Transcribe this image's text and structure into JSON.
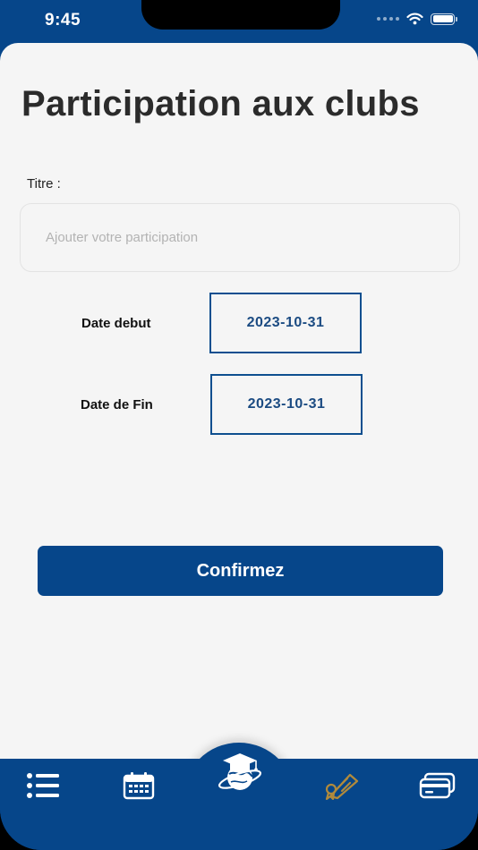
{
  "status_bar": {
    "time": "9:45"
  },
  "page": {
    "title": "Participation aux clubs"
  },
  "form": {
    "titre_label": "Titre :",
    "titre_placeholder": "Ajouter votre participation",
    "titre_value": "",
    "date_debut_label": "Date debut",
    "date_debut_value": "2023-10-31",
    "date_fin_label": "Date de Fin",
    "date_fin_value": "2023-10-31",
    "confirm_label": "Confirmez"
  },
  "tab_bar": {
    "items": [
      {
        "icon": "list-icon"
      },
      {
        "icon": "calendar-icon"
      },
      {
        "icon": "graduation-globe-icon",
        "active": true
      },
      {
        "icon": "diploma-icon",
        "color": "#b08a3c"
      },
      {
        "icon": "credit-card-icon"
      }
    ]
  },
  "colors": {
    "primary": "#06468a",
    "accent": "#b08a3c",
    "background": "#f5f5f5"
  }
}
